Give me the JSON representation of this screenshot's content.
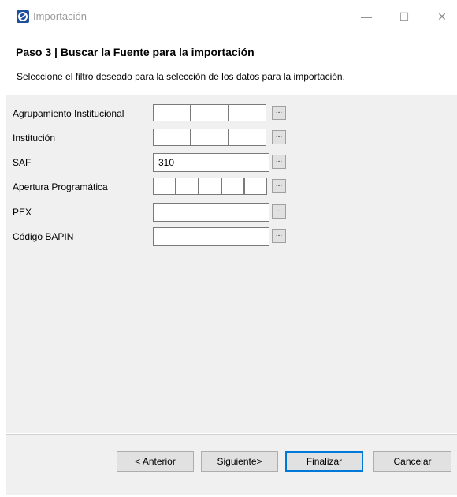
{
  "window": {
    "title": "Importación",
    "minimize_glyph": "—",
    "maximize_glyph": "☐",
    "close_glyph": "✕"
  },
  "header": {
    "step_title": "Paso 3 | Buscar la Fuente para la importación",
    "description": "Seleccione el filtro deseado para la selección de los datos para la importación."
  },
  "form": {
    "rows": [
      {
        "label": "Agrupamiento Institucional",
        "type": "segmented",
        "segments": 3,
        "value": ""
      },
      {
        "label": "Institución",
        "type": "segmented",
        "segments": 3,
        "value": ""
      },
      {
        "label": "SAF",
        "type": "text",
        "value": "310"
      },
      {
        "label": "Apertura Programática",
        "type": "segmented",
        "segments": 5,
        "value": ""
      },
      {
        "label": "PEX",
        "type": "text",
        "value": ""
      },
      {
        "label": "Código BAPIN",
        "type": "text",
        "value": ""
      }
    ],
    "browse_label": "..."
  },
  "footer": {
    "back_label": "< Anterior",
    "next_label": "Siguiente>",
    "finish_label": "Finalizar",
    "cancel_label": "Cancelar"
  },
  "colors": {
    "accent": "#0078d7",
    "panel_bg": "#f0f0f0",
    "app_icon": "#1f4e9a"
  },
  "icons": {
    "app": "app-logo-icon"
  }
}
